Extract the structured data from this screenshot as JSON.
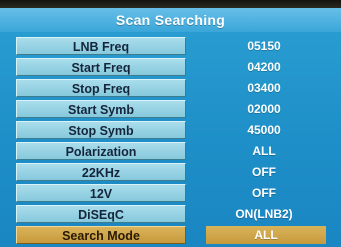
{
  "title": "Scan Searching",
  "rows": [
    {
      "label": "LNB Freq",
      "value": "05150"
    },
    {
      "label": "Start Freq",
      "value": "04200"
    },
    {
      "label": "Stop Freq",
      "value": "03400"
    },
    {
      "label": "Start Symb",
      "value": "02000"
    },
    {
      "label": "Stop Symb",
      "value": "45000"
    },
    {
      "label": "Polarization",
      "value": "ALL"
    },
    {
      "label": "22KHz",
      "value": "OFF"
    },
    {
      "label": "12V",
      "value": "OFF"
    },
    {
      "label": "DiSEqC",
      "value": "ON(LNB2)"
    },
    {
      "label": "Search Mode",
      "value": "ALL"
    }
  ],
  "selected_row": "Search Mode",
  "colors": {
    "background": "#1e8fc8",
    "title_bar": "#3aa6d9",
    "label_box": "#a9ddeb",
    "selected_highlight": "#d9b35a",
    "value_text": "#ffffff"
  }
}
